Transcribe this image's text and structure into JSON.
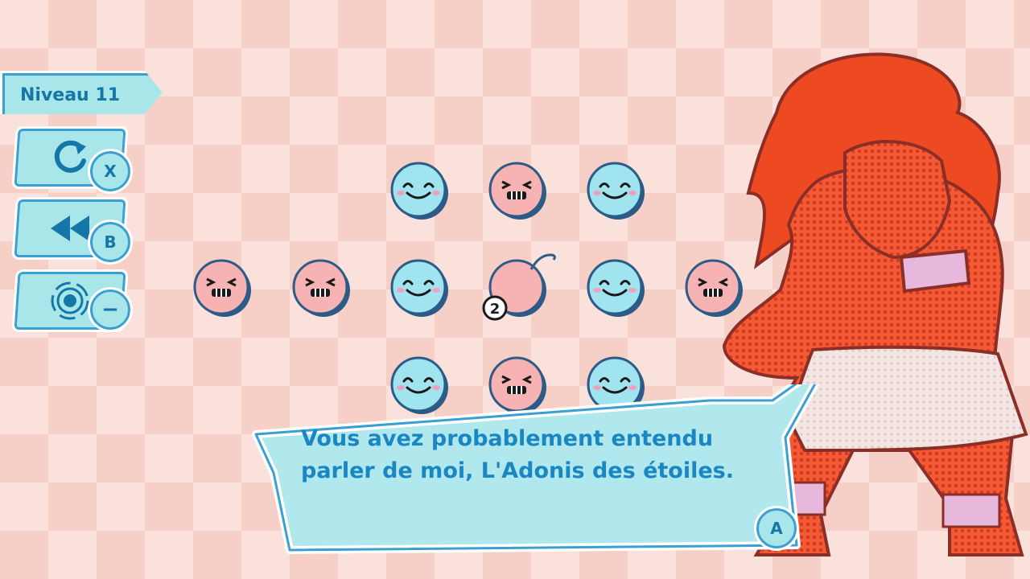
{
  "hud": {
    "level_label": "Niveau 11",
    "buttons": [
      {
        "name": "restart",
        "icon": "restart-icon",
        "key": "X"
      },
      {
        "name": "rewind",
        "icon": "rewind-icon",
        "key": "B"
      },
      {
        "name": "map",
        "icon": "orbit-icon",
        "key": "−"
      }
    ]
  },
  "board": {
    "faces": [
      {
        "type": "happy",
        "row": 0,
        "col": 2
      },
      {
        "type": "grumpy",
        "row": 0,
        "col": 3
      },
      {
        "type": "happy",
        "row": 0,
        "col": 4
      },
      {
        "type": "grumpy",
        "row": 1,
        "col": 0
      },
      {
        "type": "grumpy",
        "row": 1,
        "col": 1
      },
      {
        "type": "happy",
        "row": 1,
        "col": 2
      },
      {
        "type": "bomb",
        "row": 1,
        "col": 3
      },
      {
        "type": "happy",
        "row": 1,
        "col": 4
      },
      {
        "type": "grumpy",
        "row": 1,
        "col": 5
      },
      {
        "type": "happy",
        "row": 2,
        "col": 2
      },
      {
        "type": "grumpy",
        "row": 2,
        "col": 3
      },
      {
        "type": "happy",
        "row": 2,
        "col": 4
      }
    ],
    "bomb_counter": "2",
    "colors": {
      "happy": "#9fe4ee",
      "grumpy": "#f7b3b3",
      "outline": "#2c5b87"
    }
  },
  "dialog": {
    "text": "Vous avez probablement entendu parler de moi, L'Adonis des étoiles.",
    "continue_key": "A"
  },
  "character": {
    "name": "red-muscular-character",
    "colors": {
      "skin": "#f2502e",
      "hair": "#ee4a22",
      "skirt": "#f2e4df",
      "outline": "#8b2e27"
    }
  }
}
